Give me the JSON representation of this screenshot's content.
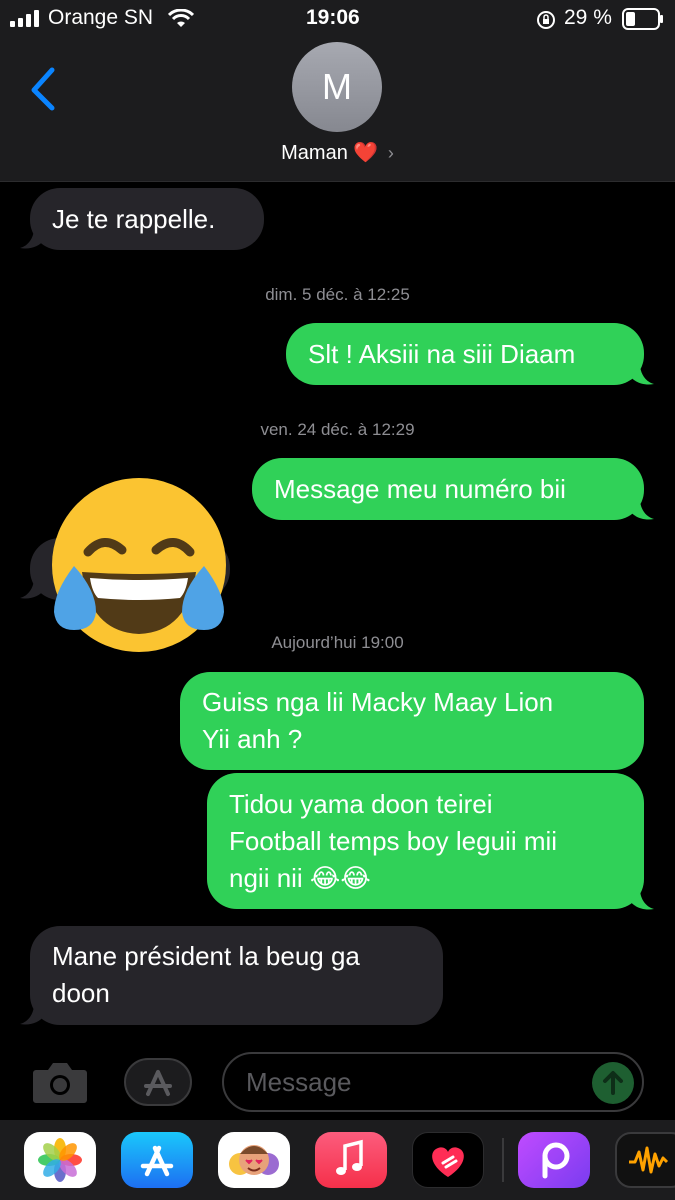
{
  "status_bar": {
    "carrier": "Orange SN",
    "time": "19:06",
    "battery": "29 %"
  },
  "header": {
    "avatar_initial": "M",
    "contact_name": "Maman ❤️"
  },
  "messages": {
    "m1": "Je te rappelle.",
    "ts1": "dim. 5 déc. à 12:25",
    "m2": "Slt ! Aksiii na siii Diaam",
    "ts2": "ven. 24 déc. à 12:29",
    "m3": "Message meu numéro bii",
    "ts3": "Aujourd’hui 19:00",
    "m4_line1": "Guiss  nga lii Macky Maay Lion",
    "m4_line2": "Yii anh ?",
    "m5_line1": "Tidou yama doon teirei",
    "m5_line2": "Football temps boy leguii mii",
    "m5_line3": "ngii nii 😂😂",
    "m6_line1": "Mane président la beug ga",
    "m6_line2": "doon"
  },
  "input": {
    "placeholder": "Message"
  },
  "colors": {
    "outgoing": "#30d158",
    "incoming": "#26252a",
    "accent": "#0a84ff"
  },
  "icons": {
    "back": "chevron-left-icon",
    "camera": "camera-icon",
    "appstore": "app-store-icon",
    "send": "arrow-up-icon",
    "dock": [
      "photos-icon",
      "app-store-icon",
      "memoji-icon",
      "music-icon",
      "heart-app-icon",
      "picsart-icon",
      "audiomack-icon"
    ]
  }
}
